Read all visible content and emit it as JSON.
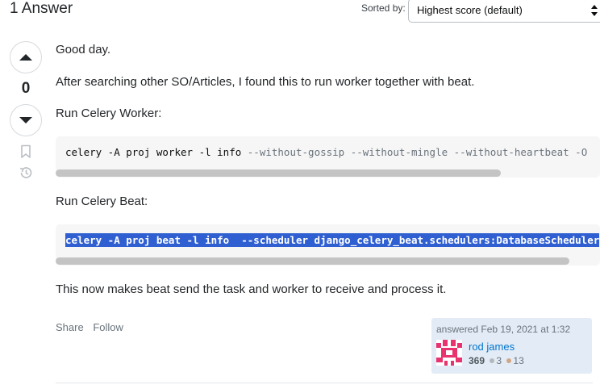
{
  "header": {
    "answers_count": "1 Answer",
    "sort_label": "Sorted by:",
    "sort_value": "Highest score (default)"
  },
  "vote": {
    "count": "0"
  },
  "answer": {
    "paragraphs": [
      "Good day.",
      "After searching other SO/Articles, I found this to run worker together with beat.",
      "Run Celery Worker:",
      "Run Celery Beat:",
      "This now makes beat send the task and worker to receive and process it."
    ],
    "code_worker": {
      "main": "celery -A proj worker -l info ",
      "flags": "--without-gossip --without-mingle --without-heartbeat -O"
    },
    "code_beat": "celery -A proj beat -l info  --scheduler django_celery_beat.schedulers:DatabaseScheduler"
  },
  "actions": {
    "share": "Share",
    "follow": "Follow"
  },
  "signature": {
    "action_time": "answered Feb 19, 2021 at 1:32",
    "user_name": "rod james",
    "reputation": "369",
    "silver_badges": "3",
    "bronze_badges": "13",
    "colors": {
      "silver": "#b4b8bc",
      "bronze": "#d1a684",
      "avatar": "#e8336e",
      "selection": "#2f5fd0",
      "link": "#0074cc"
    }
  }
}
